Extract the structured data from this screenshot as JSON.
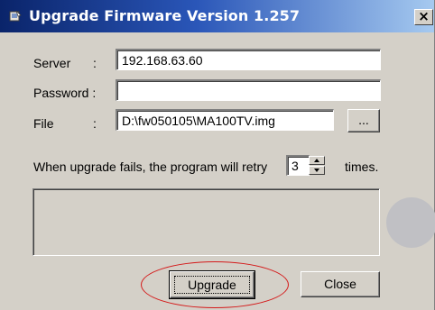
{
  "window": {
    "title": "Upgrade Firmware Version 1.257",
    "close_glyph": "×",
    "icon": "firmware-app-icon"
  },
  "form": {
    "server_label": "Server",
    "server_colon": ":",
    "server_value": "192.168.63.60",
    "password_label": "Password :",
    "password_value": "",
    "file_label": "File",
    "file_colon": ":",
    "file_value": "D:\\fw050105\\MA100TV.img",
    "browse_label": "..."
  },
  "retry": {
    "text_before": "When upgrade fails, the program will retry",
    "count": "3",
    "text_after": "times."
  },
  "buttons": {
    "upgrade_label": "Upgrade",
    "close_label": "Close"
  },
  "colors": {
    "titlebar_start": "#0a246a",
    "titlebar_end": "#a6caf0",
    "dialog_face": "#d4d0c8",
    "highlight_ellipse": "#d41a1a"
  }
}
